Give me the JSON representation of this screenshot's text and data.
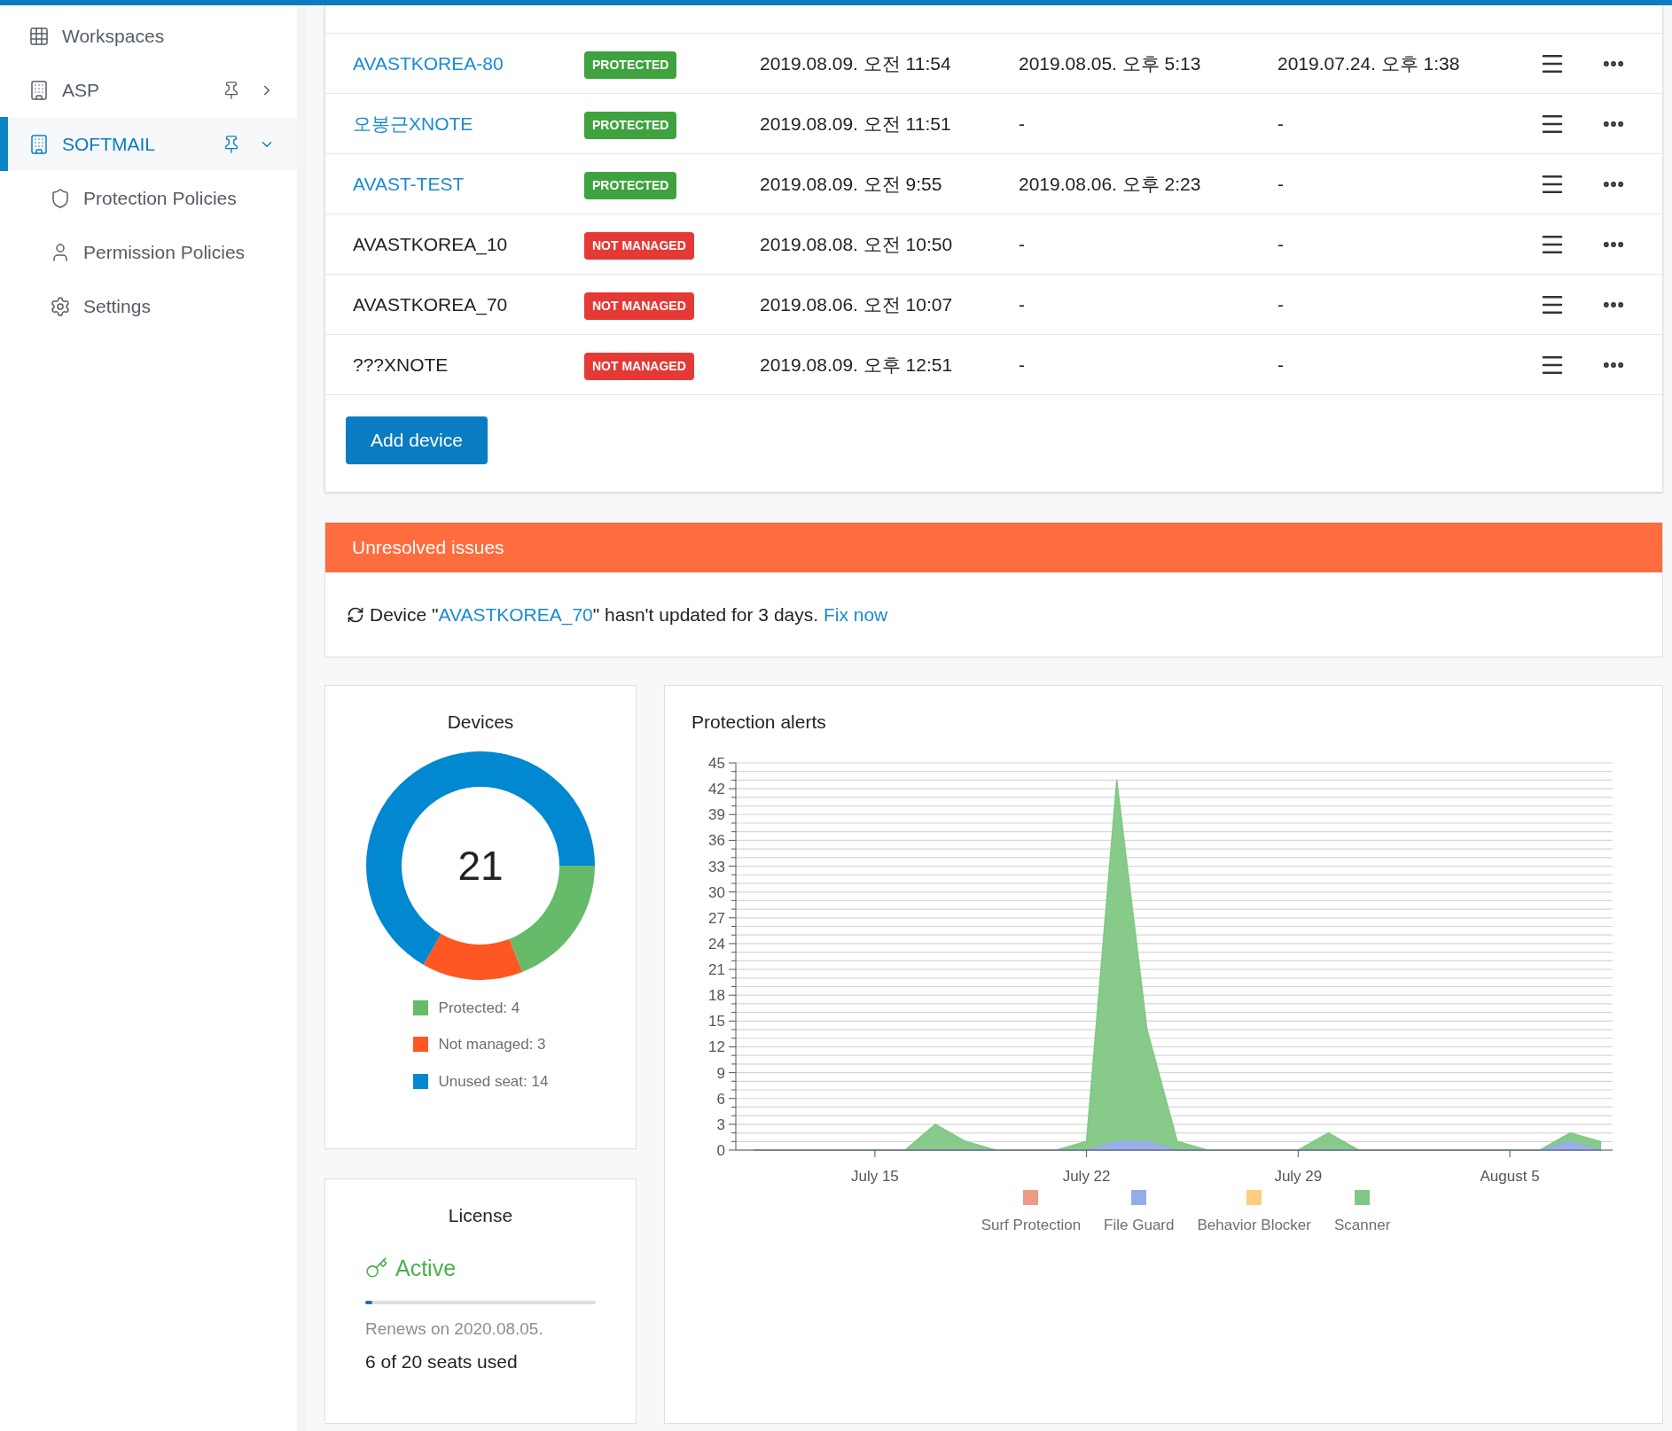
{
  "sidebar": {
    "items": [
      {
        "label": "Workspaces",
        "selected": false
      },
      {
        "label": "ASP",
        "pinnable": true,
        "expanded": false,
        "selected": false
      },
      {
        "label": "SOFTMAIL",
        "pinnable": true,
        "expanded": true,
        "selected": true,
        "children": [
          {
            "label": "Protection Policies"
          },
          {
            "label": "Permission Policies"
          },
          {
            "label": "Settings"
          }
        ]
      }
    ]
  },
  "devices_table": {
    "rows": [
      {
        "name": "AVASTKOREA-80",
        "link": true,
        "status": "PROTECTED",
        "kind": "protected",
        "column_3": "2019.08.09. 오전 11:54",
        "column_4": "2019.08.05. 오후 5:13",
        "column_5": "2019.07.24. 오후 1:38"
      },
      {
        "name": "오봉근XNOTE",
        "link": true,
        "status": "PROTECTED",
        "kind": "protected",
        "column_3": "2019.08.09. 오전 11:51",
        "column_4": "-",
        "column_5": "-"
      },
      {
        "name": "AVAST-TEST",
        "link": true,
        "status": "PROTECTED",
        "kind": "protected",
        "column_3": "2019.08.09. 오전 9:55",
        "column_4": "2019.08.06. 오후 2:23",
        "column_5": "-"
      },
      {
        "name": "AVASTKOREA_10",
        "link": false,
        "status": "NOT MANAGED",
        "kind": "not_managed",
        "column_3": "2019.08.08. 오전 10:50",
        "column_4": "-",
        "column_5": "-"
      },
      {
        "name": "AVASTKOREA_70",
        "link": false,
        "status": "NOT MANAGED",
        "kind": "not_managed",
        "column_3": "2019.08.06. 오전 10:07",
        "column_4": "-",
        "column_5": "-"
      },
      {
        "name": "???XNOTE",
        "link": false,
        "status": "NOT MANAGED",
        "kind": "not_managed",
        "column_3": "2019.08.09. 오후 12:51",
        "column_4": "-",
        "column_5": "-"
      }
    ],
    "add_button": "Add device"
  },
  "unresolved_issues": {
    "title": "Unresolved issues",
    "items": [
      {
        "before": "Device \"",
        "device": "AVASTKOREA_70",
        "after": "\" hasn't updated for 3 days.",
        "action": "Fix now"
      }
    ]
  },
  "devices_card": {
    "total": "21",
    "chart_data": {
      "type": "donut",
      "title": "Devices",
      "values": [
        19.05,
        14.28,
        66.67
      ]
    },
    "legend": [
      {
        "label": "Protected: 4",
        "color": "#66bb6a"
      },
      {
        "label": "Not managed: 3",
        "color": "#ff5722"
      },
      {
        "label": "Unused seat: 14",
        "color": "#0288d1"
      }
    ]
  },
  "license_card": {
    "title": "License",
    "status": "Active",
    "level": 0.03,
    "renews": "Renews on 2020.08.05.",
    "seats": "6 of 20 seats used"
  },
  "alerts_card": {
    "chart_data": {
      "type": "area",
      "title": "Protection alerts",
      "stacked": true,
      "grid": true,
      "categories": [
        null,
        null,
        null,
        null,
        "July 15",
        null,
        null,
        null,
        null,
        null,
        null,
        "July 22",
        null,
        null,
        null,
        null,
        null,
        null,
        "July 29",
        null,
        null,
        null,
        null,
        null,
        null,
        "August 5",
        null,
        null,
        null
      ],
      "series": [
        {
          "color": "#95acea",
          "values": [
            0,
            0,
            0,
            0,
            0,
            0,
            0,
            0,
            0,
            0,
            0,
            0,
            1,
            1,
            0,
            0,
            0,
            0,
            0,
            0,
            0,
            0,
            0,
            0,
            0,
            0,
            0,
            1,
            0
          ]
        },
        {
          "color": "#81c784",
          "values": [
            0,
            0,
            0,
            0,
            0,
            0,
            3,
            1,
            0,
            0,
            0,
            1,
            42,
            13,
            1,
            0,
            0,
            0,
            0,
            2,
            0,
            0,
            0,
            0,
            0,
            0,
            0,
            1,
            1
          ]
        }
      ],
      "ylim": [
        0,
        45
      ],
      "yticks": [
        0,
        3,
        6,
        9,
        12,
        15,
        18,
        21,
        24,
        27,
        30,
        33,
        36,
        39,
        42,
        45
      ]
    },
    "legend": [
      {
        "label": "Surf Protection",
        "color": "#ee9a85"
      },
      {
        "label": "File Guard",
        "color": "#95acea"
      },
      {
        "label": "Behavior Blocker",
        "color": "#ffcc80"
      },
      {
        "label": "Scanner",
        "color": "#81c784"
      }
    ]
  }
}
